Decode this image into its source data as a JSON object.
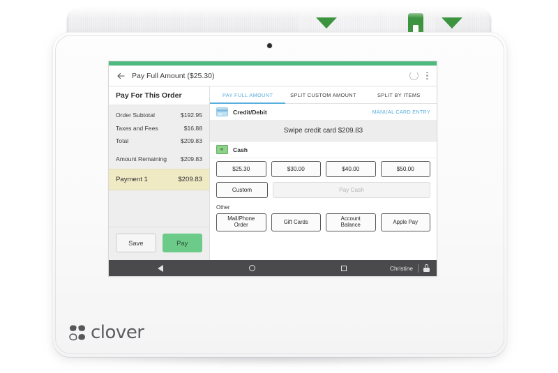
{
  "device": {
    "brand": "clover",
    "reader": {
      "left_arrow_icon": "triangle-down-icon",
      "right_arrow_icon": "triangle-down-icon",
      "card_slot_icon": "card-slot-icon"
    },
    "camera_icon": "camera-dot-icon"
  },
  "app_bar": {
    "back_icon": "back-arrow-icon",
    "title": "Pay Full Amount ($25.30)",
    "refresh_icon": "refresh-icon",
    "overflow_icon": "overflow-menu-icon"
  },
  "sidebar": {
    "header": "Pay For This Order",
    "totals": [
      {
        "label": "Order Subtotal",
        "value": "$192.95"
      },
      {
        "label": "Taxes and Fees",
        "value": "$16.88"
      },
      {
        "label": "Total",
        "value": "$209.83"
      },
      {
        "label": "Amount Remaining",
        "value": "$209.83"
      }
    ],
    "payment": {
      "label": "Payment 1",
      "value": "$209.83"
    },
    "actions": {
      "save_label": "Save",
      "pay_label": "Pay"
    }
  },
  "tabs": [
    {
      "label": "PAY FULL AMOUNT",
      "active": true
    },
    {
      "label": "SPLIT CUSTOM AMOUNT",
      "active": false
    },
    {
      "label": "SPLIT BY ITEMS",
      "active": false
    }
  ],
  "credit": {
    "icon": "credit-card-icon",
    "label": "Credit/Debit",
    "manual_entry_label": "MANUAL CARD ENTRY",
    "swipe_prompt": "Swipe credit card $209.83"
  },
  "cash": {
    "icon": "cash-icon",
    "label": "Cash",
    "quick_amounts": [
      "$25.30",
      "$30.00",
      "$40.00",
      "$50.00"
    ],
    "custom_label": "Custom",
    "pay_cash_label": "Pay Cash"
  },
  "other": {
    "label": "Other",
    "buttons": [
      "Mail/Phone\nOrder",
      "Gift Cards",
      "Account\nBalance",
      "Apple Pay"
    ]
  },
  "nav_bar": {
    "back_icon": "nav-back-icon",
    "home_icon": "nav-home-icon",
    "recents_icon": "nav-recents-icon",
    "user": "Christine",
    "lock_icon": "lock-icon"
  },
  "colors": {
    "status_strip": "#4fb97f",
    "accent_blue": "#58aedd",
    "pay_green": "#6ccb89",
    "payment_highlight": "#f0eac4",
    "nav_bar": "#4a4a4c",
    "reader_green": "#3d9440"
  }
}
